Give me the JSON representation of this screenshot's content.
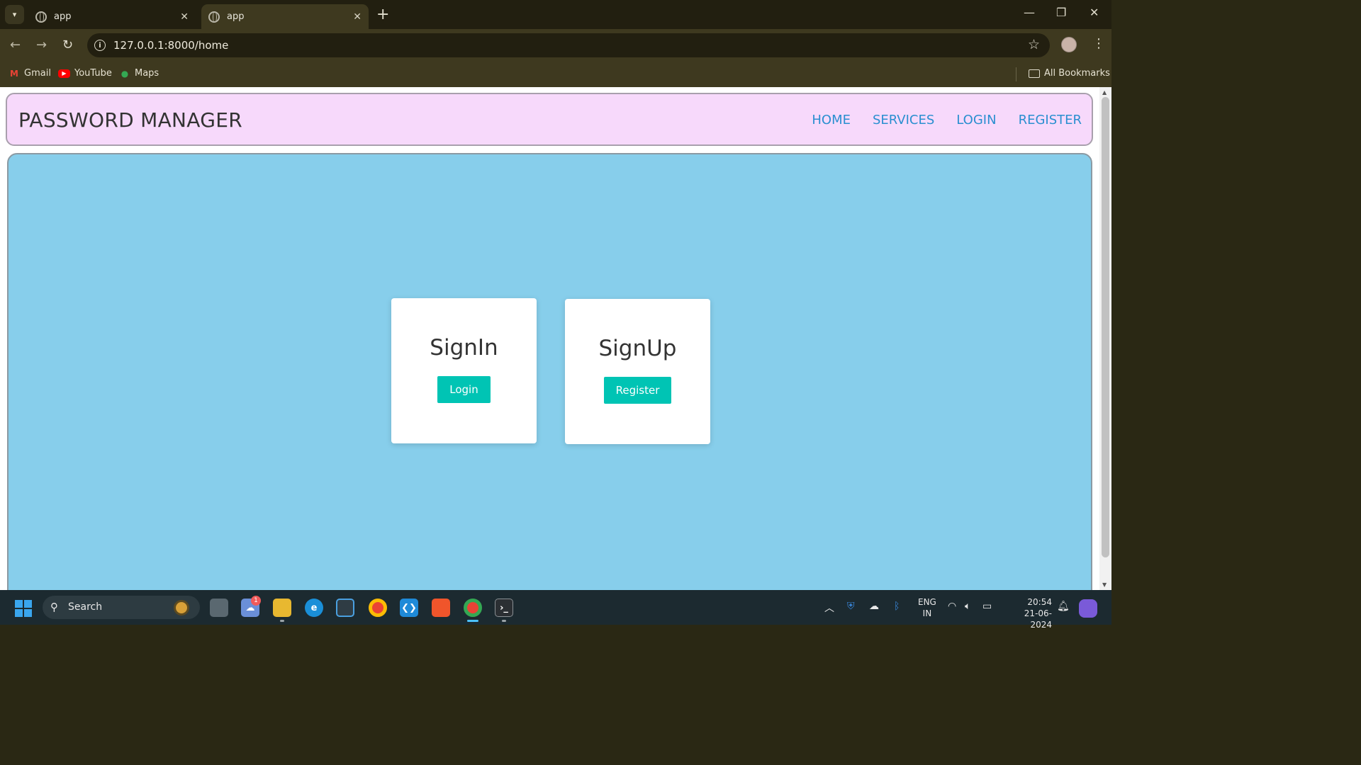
{
  "browser": {
    "tabs": [
      {
        "title": "app",
        "active": false
      },
      {
        "title": "app",
        "active": true
      }
    ],
    "url": "127.0.0.1:8000/home",
    "bookmarks": [
      {
        "label": "Gmail",
        "icon": "gmail-icon"
      },
      {
        "label": "YouTube",
        "icon": "youtube-icon"
      },
      {
        "label": "Maps",
        "icon": "maps-icon"
      }
    ],
    "all_bookmarks_label": "All Bookmarks"
  },
  "site": {
    "brand": "PASSWORD MANAGER",
    "nav": [
      {
        "label": "HOME"
      },
      {
        "label": "SERVICES"
      },
      {
        "label": "LOGIN"
      },
      {
        "label": "REGISTER"
      }
    ],
    "colors": {
      "navbar_bg": "#f7d9fb",
      "hero_bg": "#87ceeb",
      "link": "#2a8fd0",
      "button": "#00c4b4"
    },
    "cards": [
      {
        "title": "SignIn",
        "button": "Login"
      },
      {
        "title": "SignUp",
        "button": "Register"
      }
    ]
  },
  "taskbar": {
    "search_label": "Search",
    "weather_badge": "1",
    "language": "ENG",
    "region": "IN",
    "time": "20:54",
    "date": "21-06-2024"
  }
}
